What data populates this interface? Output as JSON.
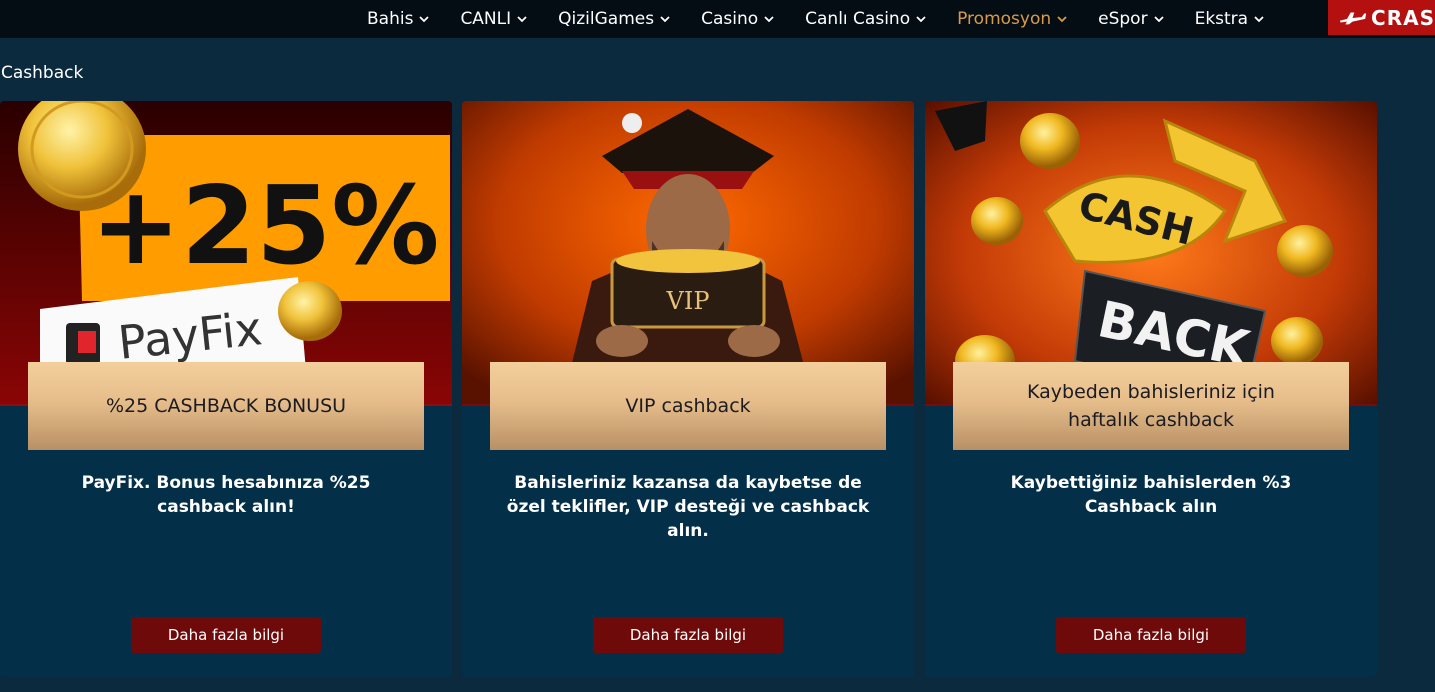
{
  "nav": {
    "items": [
      {
        "label": "Bahis",
        "active": false
      },
      {
        "label": "CANLI",
        "active": false
      },
      {
        "label": "QizilGames",
        "active": false
      },
      {
        "label": "Casino",
        "active": false
      },
      {
        "label": "Canlı Casino",
        "active": false
      },
      {
        "label": "Promosyon",
        "active": true
      },
      {
        "label": "eSpor",
        "active": false
      },
      {
        "label": "Ekstra",
        "active": false
      }
    ],
    "crash_label": "CRAS",
    "active_color": "#d99b4a"
  },
  "section": {
    "title": "Cashback"
  },
  "cards": [
    {
      "banner_text": "+25%",
      "banner_logo": "PayFix",
      "title": "%25 CASHBACK BONUSU",
      "description": "PayFix. Bonus hesabınıza %25 cashback alın!",
      "button": "Daha fazla bilgi"
    },
    {
      "banner_text": "VIP",
      "title": "VIP cashback",
      "description": "Bahisleriniz kazansa da kaybetse de özel teklifler, VIP desteği ve cashback alın.",
      "button": "Daha fazla bilgi"
    },
    {
      "banner_text": "CASH",
      "banner_text2": "BACK",
      "title": "Kaybeden bahisleriniz için haftalık cashback",
      "description": "Kaybettiğiniz bahislerden %3 Cashback alın",
      "button": "Daha fazla bilgi"
    }
  ],
  "colors": {
    "background": "#0b2a3d",
    "card": "#032f49",
    "button": "#6f0a0a",
    "crash": "#b3100f"
  }
}
